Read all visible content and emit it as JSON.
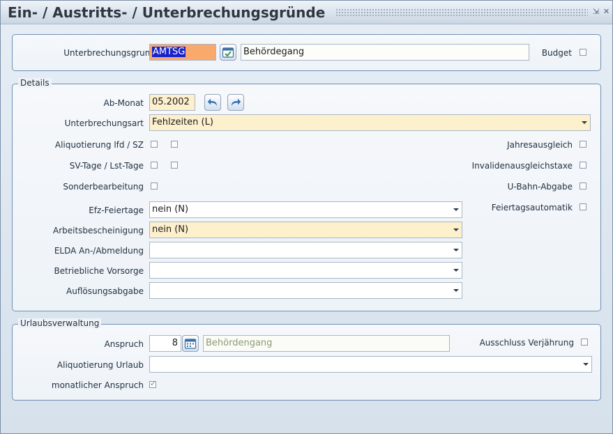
{
  "window": {
    "title": "Ein- / Austritts- / Unterbrechungsgründe"
  },
  "top": {
    "unterbrechungsgrund_label": "Unterbrechungsgrund",
    "code_value": "AMTSG",
    "description_value": "Behördegang",
    "budget_label": "Budget",
    "budget_checked": false
  },
  "details": {
    "legend": "Details",
    "ab_monat_label": "Ab-Monat",
    "ab_monat_value": "05.2002",
    "unterbrechungsart_label": "Unterbrechungsart",
    "unterbrechungsart_value": "Fehlzeiten (L)",
    "aliquotierung_label": "Aliquotierung lfd / SZ",
    "svtage_label": "SV-Tage / Lst-Tage",
    "sonderbearbeitung_label": "Sonderbearbeitung",
    "jahresausgleich_label": "Jahresausgleich",
    "invaliden_label": "Invalidenausgleichstaxe",
    "ubahn_label": "U-Bahn-Abgabe",
    "feiertagsautomatik_label": "Feiertagsautomatik",
    "efz_label": "Efz-Feiertage",
    "efz_value": "nein (N)",
    "arbeitsbescheinigung_label": "Arbeitsbescheinigung",
    "arbeitsbescheinigung_value": "nein (N)",
    "elda_label": "ELDA An-/Abmeldung",
    "elda_value": "",
    "vorsorge_label": "Betriebliche Vorsorge",
    "vorsorge_value": "",
    "aufloesung_label": "Auflösungsabgabe",
    "aufloesung_value": ""
  },
  "urlaub": {
    "legend": "Urlaubsverwaltung",
    "anspruch_label": "Anspruch",
    "anspruch_value": "8",
    "anspruch_desc": "Behördengang",
    "ausschluss_label": "Ausschluss Verjährung",
    "aliquotierung_label": "Aliquotierung Urlaub",
    "aliquotierung_value": "",
    "monatlich_label": "monatlicher Anspruch",
    "monatlich_checked": true
  },
  "colors": {
    "accent_orange": "#f8a96b",
    "field_yellow": "#fdf0cd",
    "panel_border": "#6f8fb5",
    "selection_blue": "#1722c8"
  }
}
